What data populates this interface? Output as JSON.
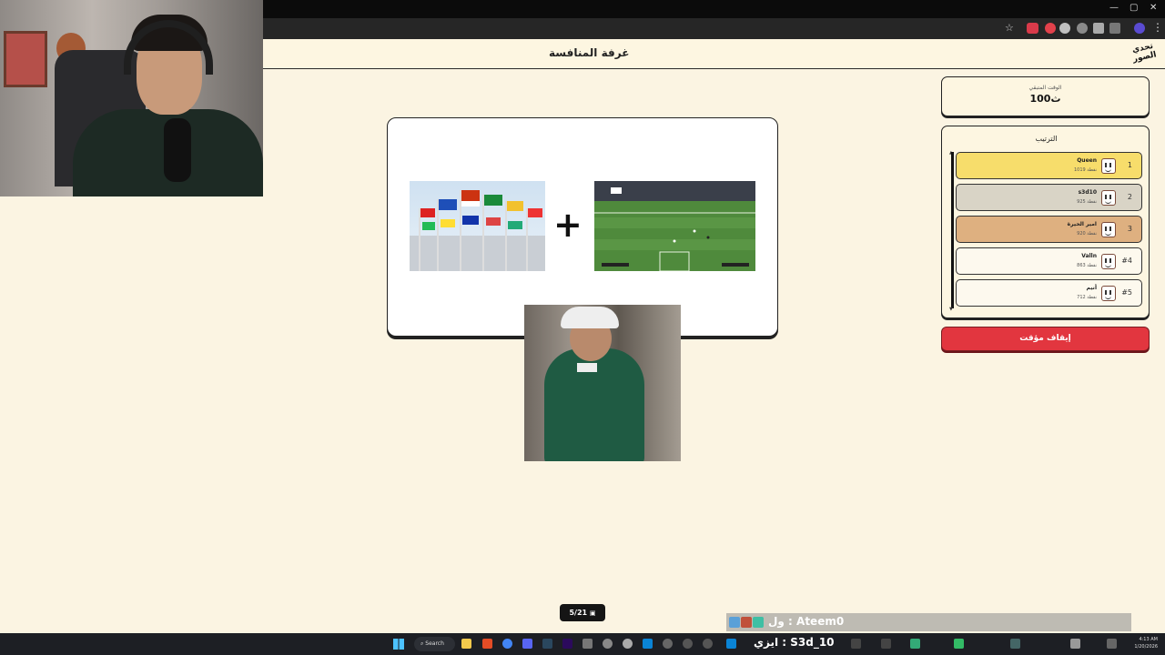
{
  "app": {
    "page_title": "غرفة المنافسة",
    "logo_text": "تحدي الصور"
  },
  "question": {
    "image1_alt": "flags",
    "image2_alt": "football",
    "operator": "+"
  },
  "timer": {
    "label": "الوقت المتبقي",
    "value": "100ث"
  },
  "ranking": {
    "title": "الترتيب",
    "rows": [
      {
        "rank": "1",
        "name": "Queen",
        "points": "1019 نقطة",
        "color": "#f7dd6b"
      },
      {
        "rank": "2",
        "name": "s3d10",
        "points": "925 نقطة",
        "color": "#d9d4c6"
      },
      {
        "rank": "3",
        "name": "امير الحيرة",
        "points": "920 نقطة",
        "color": "#deb080"
      },
      {
        "rank": "#4",
        "name": "Valln",
        "points": "863 نقطة",
        "color": "#fdf9ee"
      },
      {
        "rank": "#5",
        "name": "أنيم",
        "points": "712 نقطة",
        "color": "#fdf9ee"
      }
    ]
  },
  "stop_button": "إيقاف مؤقت",
  "counter": "5/21",
  "chat": {
    "text": "ول : Ateem0"
  },
  "taskbar": {
    "search": "Search",
    "stream_text": "ايزي : S3d_10",
    "time": "4:13 AM",
    "date": "1/20/2026"
  },
  "window": {
    "minimize": "—",
    "maximize": "▢",
    "close": "✕"
  }
}
